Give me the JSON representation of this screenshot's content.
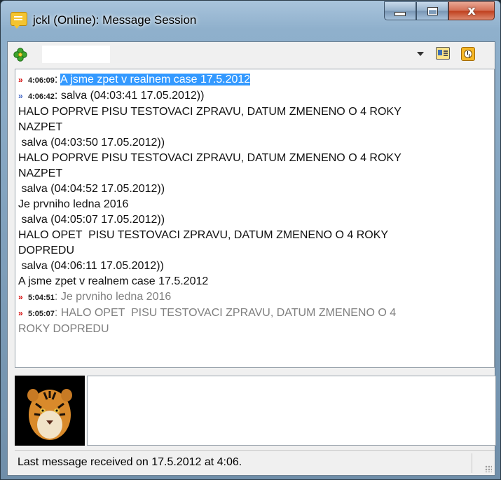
{
  "window": {
    "title": "jckl (Online): Message Session",
    "minimize_label": "",
    "maximize_label": "",
    "close_label": "x"
  },
  "toolbar": {
    "icons": [
      "clover-icon",
      "dropdown-arrow-icon",
      "contact-card-icon",
      "history-clock-icon"
    ]
  },
  "messages": [
    {
      "arrow": "»",
      "arrow_color": "red",
      "time": "4:06:09",
      "text": "A jsme zpet v realnem case 17.5.2012",
      "selected": true
    },
    {
      "arrow": "»",
      "arrow_color": "blue",
      "time": "4:06:42",
      "text": "salva (04:03:41 17.05.2012))"
    },
    {
      "plain": "HALO POPRVE PISU TESTOVACI ZPRAVU, DATUM ZMENENO O 4 ROKY"
    },
    {
      "plain": "NAZPET"
    },
    {
      "plain": " salva (04:03:50 17.05.2012))"
    },
    {
      "plain": "HALO POPRVE PISU TESTOVACI ZPRAVU, DATUM ZMENENO O 4 ROKY"
    },
    {
      "plain": "NAZPET"
    },
    {
      "plain": " salva (04:04:52 17.05.2012))"
    },
    {
      "plain": "Je prvniho ledna 2016"
    },
    {
      "plain": " salva (04:05:07 17.05.2012))"
    },
    {
      "plain": "HALO OPET  PISU TESTOVACI ZPRAVU, DATUM ZMENENO O 4 ROKY"
    },
    {
      "plain": "DOPREDU"
    },
    {
      "plain": " salva (04:06:11 17.05.2012))"
    },
    {
      "plain": "A jsme zpet v realnem case 17.5.2012"
    },
    {
      "arrow": "»",
      "arrow_color": "red",
      "time": "5:04:51",
      "text": "Je prvniho ledna 2016",
      "gray": true
    },
    {
      "arrow": "»",
      "arrow_color": "red",
      "time": "5:05:07",
      "text": "HALO OPET  PISU TESTOVACI ZPRAVU, DATUM ZMENENO O 4",
      "gray": true
    },
    {
      "plain": "ROKY DOPREDU",
      "gray": true
    }
  ],
  "avatar": {
    "icon": "tiger-avatar"
  },
  "status": {
    "text": "Last message received on 17.5.2012 at 4:06."
  },
  "colors": {
    "selection": "#3399ff",
    "incoming_arrow": "#d40000",
    "outgoing_arrow": "#3d62c4",
    "history_text": "#7f7f7f"
  }
}
